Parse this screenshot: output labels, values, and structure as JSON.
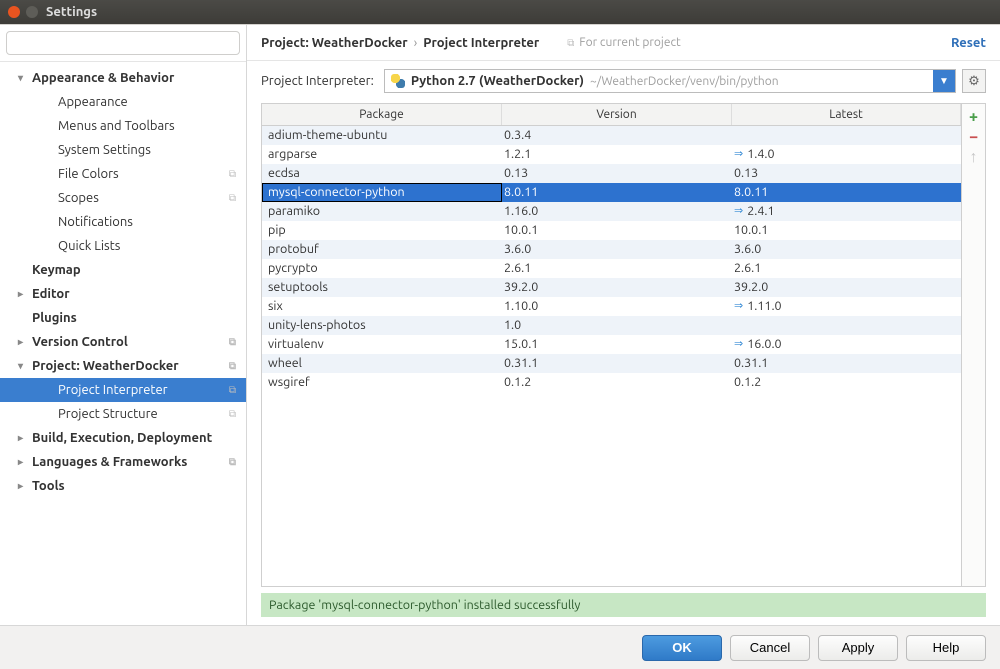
{
  "title": "Settings",
  "search_placeholder": "",
  "tree": [
    {
      "label": "Appearance & Behavior",
      "level": 1,
      "caret": "▾",
      "bold": true
    },
    {
      "label": "Appearance",
      "level": 2
    },
    {
      "label": "Menus and Toolbars",
      "level": 2
    },
    {
      "label": "System Settings",
      "level": 2,
      "caret": "▸",
      "has_ind": false
    },
    {
      "label": "File Colors",
      "level": 2,
      "has_ind": true
    },
    {
      "label": "Scopes",
      "level": 2,
      "has_ind": true
    },
    {
      "label": "Notifications",
      "level": 2
    },
    {
      "label": "Quick Lists",
      "level": 2
    },
    {
      "label": "Keymap",
      "level": 1,
      "bold": true,
      "no_caret": true
    },
    {
      "label": "Editor",
      "level": 1,
      "caret": "▸",
      "bold": true
    },
    {
      "label": "Plugins",
      "level": 1,
      "bold": true,
      "no_caret": true
    },
    {
      "label": "Version Control",
      "level": 1,
      "caret": "▸",
      "bold": true,
      "has_ind": true
    },
    {
      "label": "Project: WeatherDocker",
      "level": 1,
      "caret": "▾",
      "bold": true,
      "has_ind": true
    },
    {
      "label": "Project Interpreter",
      "level": 2,
      "has_ind": true,
      "selected": true
    },
    {
      "label": "Project Structure",
      "level": 2,
      "has_ind": true
    },
    {
      "label": "Build, Execution, Deployment",
      "level": 1,
      "caret": "▸",
      "bold": true
    },
    {
      "label": "Languages & Frameworks",
      "level": 1,
      "caret": "▸",
      "bold": true,
      "has_ind": true
    },
    {
      "label": "Tools",
      "level": 1,
      "caret": "▸",
      "bold": true
    }
  ],
  "breadcrumb": {
    "project": "Project: WeatherDocker",
    "sep": "›",
    "page": "Project Interpreter",
    "for_current": "For current project",
    "reset": "Reset"
  },
  "interpreter": {
    "label": "Project Interpreter:",
    "value": "Python 2.7 (WeatherDocker)",
    "path": "~/WeatherDocker/venv/bin/python"
  },
  "columns": {
    "name": "Package",
    "version": "Version",
    "latest": "Latest"
  },
  "packages": [
    {
      "name": "adium-theme-ubuntu",
      "version": "0.3.4",
      "latest": "",
      "up": false
    },
    {
      "name": "argparse",
      "version": "1.2.1",
      "latest": "1.4.0",
      "up": true
    },
    {
      "name": "ecdsa",
      "version": "0.13",
      "latest": "0.13",
      "up": false
    },
    {
      "name": "mysql-connector-python",
      "version": "8.0.11",
      "latest": "8.0.11",
      "up": false,
      "selected": true
    },
    {
      "name": "paramiko",
      "version": "1.16.0",
      "latest": "2.4.1",
      "up": true
    },
    {
      "name": "pip",
      "version": "10.0.1",
      "latest": "10.0.1",
      "up": false
    },
    {
      "name": "protobuf",
      "version": "3.6.0",
      "latest": "3.6.0",
      "up": false
    },
    {
      "name": "pycrypto",
      "version": "2.6.1",
      "latest": "2.6.1",
      "up": false
    },
    {
      "name": "setuptools",
      "version": "39.2.0",
      "latest": "39.2.0",
      "up": false
    },
    {
      "name": "six",
      "version": "1.10.0",
      "latest": "1.11.0",
      "up": true
    },
    {
      "name": "unity-lens-photos",
      "version": "1.0",
      "latest": "",
      "up": false
    },
    {
      "name": "virtualenv",
      "version": "15.0.1",
      "latest": "16.0.0",
      "up": true
    },
    {
      "name": "wheel",
      "version": "0.31.1",
      "latest": "0.31.1",
      "up": false
    },
    {
      "name": "wsgiref",
      "version": "0.1.2",
      "latest": "0.1.2",
      "up": false
    }
  ],
  "status": "Package 'mysql-connector-python' installed successfully",
  "buttons": {
    "ok": "OK",
    "cancel": "Cancel",
    "apply": "Apply",
    "help": "Help"
  }
}
